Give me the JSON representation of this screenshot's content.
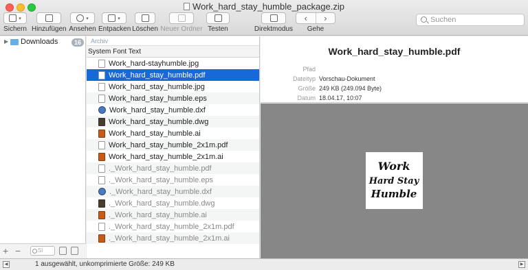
{
  "window": {
    "title": "Work_hard_stay_humble_package.zip"
  },
  "toolbar": {
    "items": [
      {
        "label": "Sichern",
        "icon": "save-icon",
        "enabled": true
      },
      {
        "label": "Hinzufügen",
        "icon": "add-file-icon",
        "enabled": true
      },
      {
        "label": "Ansehen",
        "icon": "quicklook-icon",
        "enabled": true
      },
      {
        "label": "Entpacken",
        "icon": "extract-icon",
        "enabled": true
      },
      {
        "label": "Löschen",
        "icon": "trash-icon",
        "enabled": true
      },
      {
        "label": "Neuer Ordner",
        "icon": "new-folder-icon",
        "enabled": false
      },
      {
        "label": "Testen",
        "icon": "test-icon",
        "enabled": true
      },
      {
        "label": "Direktmodus",
        "icon": "direct-mode-icon",
        "enabled": true
      },
      {
        "label": "Gehe",
        "icon": "back-forward-icon",
        "enabled": true
      }
    ],
    "search_placeholder": "Suchen"
  },
  "sidebar": {
    "items": [
      {
        "label": "Downloads",
        "badge": "16"
      }
    ],
    "search_placeholder": "Sl"
  },
  "filelist": {
    "path": "Archiv",
    "column_header": "System Font Text",
    "files": [
      {
        "name": "Work_hard-stayhumble.jpg",
        "icon": "image-file-icon",
        "selected": false,
        "dim": false
      },
      {
        "name": "Work_hard_stay_humble.pdf",
        "icon": "pdf-file-icon",
        "selected": true,
        "dim": false
      },
      {
        "name": "Work_hard_stay_humble.jpg",
        "icon": "image-file-icon",
        "selected": false,
        "dim": false
      },
      {
        "name": "Work_hard_stay_humble.eps",
        "icon": "eps-file-icon",
        "selected": false,
        "dim": false
      },
      {
        "name": "Work_hard_stay_humble.dxf",
        "icon": "dxf-file-icon",
        "selected": false,
        "dim": false
      },
      {
        "name": "Work_hard_stay_humble.dwg",
        "icon": "dwg-file-icon",
        "selected": false,
        "dim": false
      },
      {
        "name": "Work_hard_stay_humble.ai",
        "icon": "ai-file-icon",
        "selected": false,
        "dim": false
      },
      {
        "name": "Work_hard_stay_humble_2x1m.pdf",
        "icon": "pdf-file-icon",
        "selected": false,
        "dim": false
      },
      {
        "name": "Work_hard_stay_humble_2x1m.ai",
        "icon": "ai-file-icon",
        "selected": false,
        "dim": false
      },
      {
        "name": "._Work_hard_stay_humble.pdf",
        "icon": "pdf-file-icon",
        "selected": false,
        "dim": true
      },
      {
        "name": "._Work_hard_stay_humble.eps",
        "icon": "eps-file-icon",
        "selected": false,
        "dim": true
      },
      {
        "name": "._Work_hard_stay_humble.dxf",
        "icon": "dxf-file-icon",
        "selected": false,
        "dim": true
      },
      {
        "name": "._Work_hard_stay_humble.dwg",
        "icon": "dwg-file-icon",
        "selected": false,
        "dim": true
      },
      {
        "name": "._Work_hard_stay_humble.ai",
        "icon": "ai-file-icon",
        "selected": false,
        "dim": true
      },
      {
        "name": "._Work_hard_stay_humble_2x1m.pdf",
        "icon": "pdf-file-icon",
        "selected": false,
        "dim": true
      },
      {
        "name": "._Work_hard_stay_humble_2x1m.ai",
        "icon": "ai-file-icon",
        "selected": false,
        "dim": true
      }
    ]
  },
  "preview": {
    "title": "Work_hard_stay_humble.pdf",
    "fields": [
      {
        "key": "Pfad",
        "value": ""
      },
      {
        "key": "Dateityp",
        "value": "Vorschau-Dokument"
      },
      {
        "key": "Größe",
        "value": "249 KB (249.094 Byte)"
      },
      {
        "key": "Datum",
        "value": "18.04.17, 10:07"
      }
    ],
    "thumbnail_text": [
      "Work",
      "Hard Stay",
      "Humble"
    ]
  },
  "status": {
    "text": "1 ausgewählt, unkomprimierte Größe: 249 KB"
  },
  "colors": {
    "selection": "#1769d9",
    "preview_bg": "#878787",
    "badge": "#a9b1bb"
  }
}
